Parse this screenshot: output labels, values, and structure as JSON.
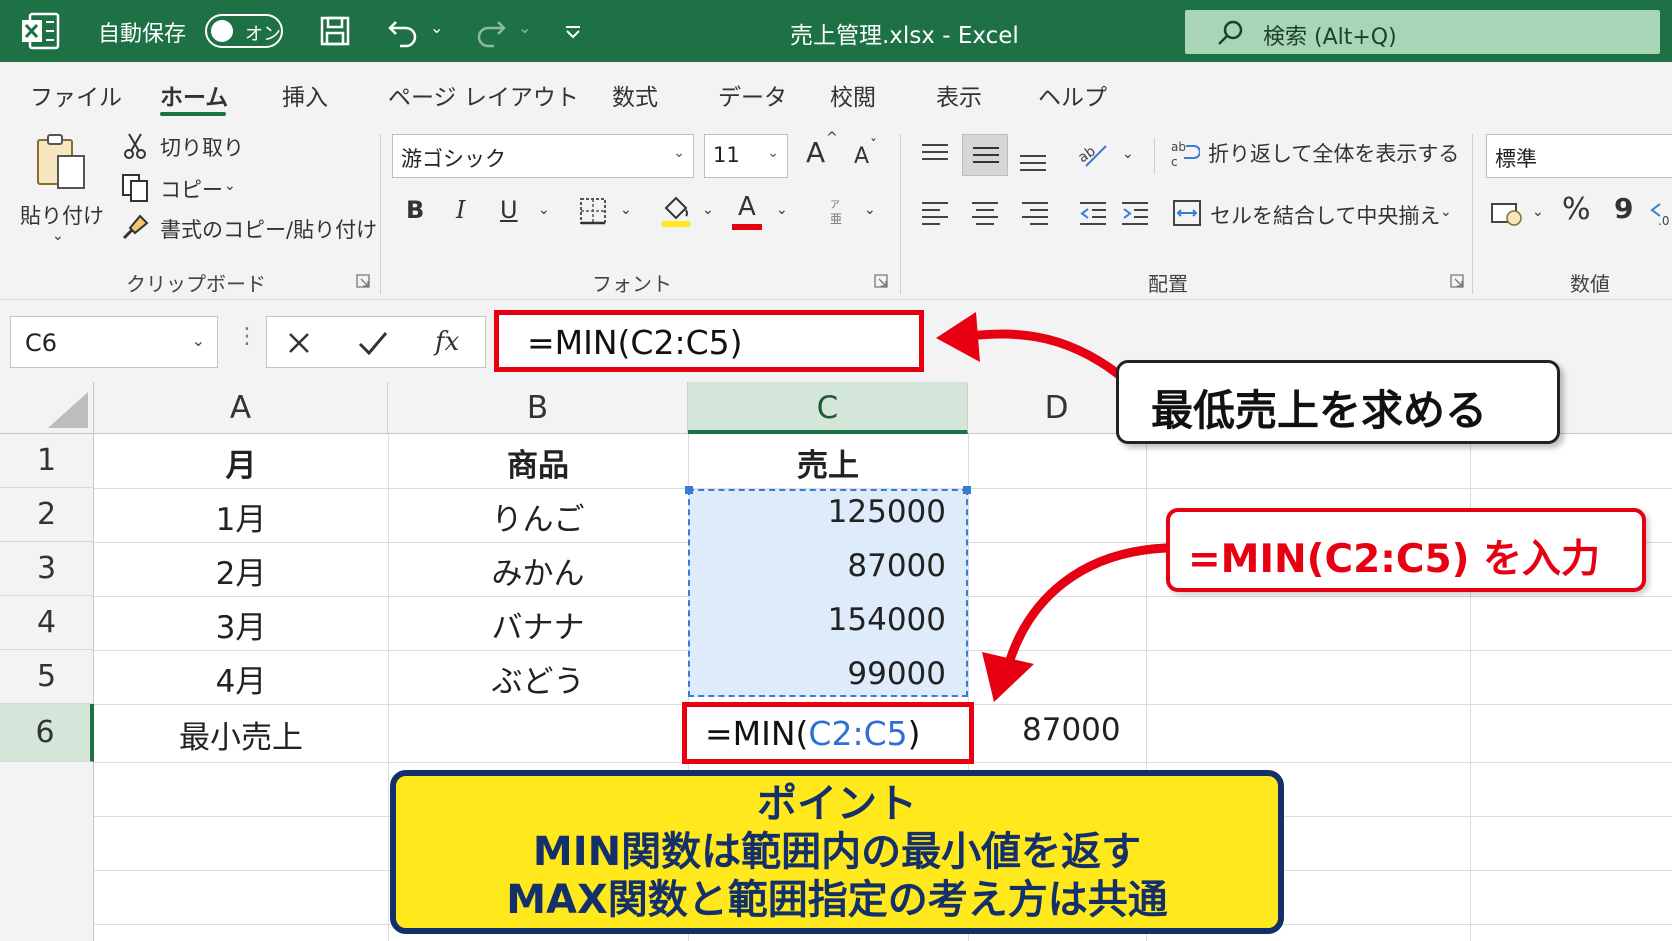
{
  "titlebar": {
    "autosave_label": "自動保存",
    "toggle_label": "オン",
    "document_title": "売上管理.xlsx  -  Excel",
    "search_placeholder": "検索 (Alt+Q)"
  },
  "tabs": [
    "ファイル",
    "ホーム",
    "挿入",
    "ページ レイアウト",
    "数式",
    "データ",
    "校閲",
    "表示",
    "ヘルプ"
  ],
  "active_tab": "ホーム",
  "ribbon": {
    "clipboard": {
      "paste_label": "貼り付け",
      "cut_label": "切り取り",
      "copy_label": "コピー",
      "format_painter_label": "書式のコピー/貼り付け",
      "group_label": "クリップボード"
    },
    "font": {
      "font_name": "游ゴシック",
      "font_size": "11",
      "grow_label": "A",
      "shrink_label": "A",
      "bold_label": "B",
      "italic_label": "I",
      "underline_label": "U",
      "font_color_label": "A",
      "group_label": "フォント"
    },
    "alignment": {
      "wrap_text_label": "折り返して全体を表示する",
      "merge_center_label": "セルを結合して中央揃え",
      "group_label": "配置"
    },
    "number": {
      "format_value": "標準",
      "percent_label": "%",
      "comma_label": "9",
      "group_label": "数値"
    }
  },
  "formula_bar": {
    "name_box": "C6",
    "fx_label": "fx",
    "formula": "=MIN(C2:C5)"
  },
  "sheet": {
    "columns": [
      "A",
      "B",
      "C",
      "D"
    ],
    "rows": [
      "1",
      "2",
      "3",
      "4",
      "5",
      "6"
    ],
    "headers": [
      "月",
      "商品",
      "売上"
    ],
    "data": [
      {
        "month": "1月",
        "product": "りんご",
        "sales": "125000"
      },
      {
        "month": "2月",
        "product": "みかん",
        "sales": "87000"
      },
      {
        "month": "3月",
        "product": "バナナ",
        "sales": "154000"
      },
      {
        "month": "4月",
        "product": "ぶどう",
        "sales": "99000"
      }
    ],
    "summary_label": "最小売上",
    "active_cell_prefix": "=MIN(",
    "active_cell_ref": "C2:C5",
    "active_cell_suffix": ")",
    "result_value": "87000"
  },
  "annotations": {
    "callout_min": "最低売上を求める",
    "callout_input": "=MIN(C2:C5) を入力",
    "point_title": "ポイント",
    "point_line1": "MIN関数は範囲内の最小値を返す",
    "point_line2": "MAX関数と範囲指定の考え方は共通"
  },
  "colors": {
    "excel_green": "#1e7145",
    "highlight_red": "#e60012",
    "selection_blue": "#deebfa",
    "point_yellow": "#ffe81c",
    "point_navy": "#13306b"
  },
  "icons": [
    "excel-logo-icon",
    "save-icon",
    "undo-icon",
    "redo-icon",
    "customize-icon",
    "search-icon",
    "paste-icon",
    "scissors-icon",
    "copy-icon",
    "brush-icon",
    "border-icon",
    "fill-color-icon",
    "align-icon",
    "orientation-icon",
    "wrap-icon",
    "merge-icon",
    "currency-icon",
    "cancel-icon",
    "check-icon",
    "arrow-icon"
  ]
}
